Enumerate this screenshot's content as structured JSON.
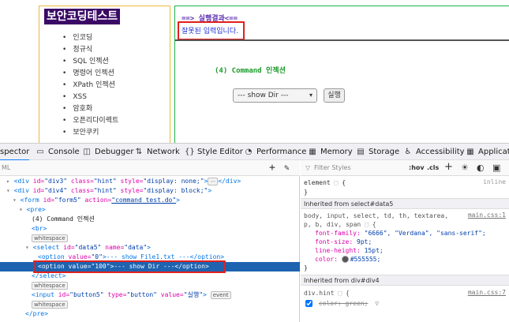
{
  "page": {
    "site_title": "보안코딩테스트",
    "nav": [
      "인코딩",
      "정규식",
      "SQL 인젝션",
      "명령어 인젝션",
      "XPath 인젝션",
      "XSS",
      "암호화",
      "오픈리다이렉트",
      "보안쿠키"
    ],
    "result_title": "==> 실행결과<==",
    "result_message": "잘못된 입력입니다.",
    "command_title": "(4) Command 인젝션",
    "select_value": "--- show Dir ---",
    "run_button": "실행"
  },
  "devtools": {
    "tabs": [
      "spector",
      "Console",
      "Debugger",
      "Network",
      "Style Editor",
      "Performance",
      "Memory",
      "Storage",
      "Accessibility",
      "Applicatio"
    ],
    "left_toolbar_label": "ML",
    "tree": {
      "l1_tag": "<div ",
      "l1_a1": "id=",
      "l1_v1": "\"div3\"",
      "l1_a2": " class=",
      "l1_v2": "\"hint\"",
      "l1_a3": " style=",
      "l1_v3": "\"display: none;\"",
      "l1_end": ">",
      "l1_close": "</div>",
      "l2_tag": "<div ",
      "l2_a1": "id=",
      "l2_v1": "\"div4\"",
      "l2_a2": " class=",
      "l2_v2": "\"hint\"",
      "l2_a3": " style=",
      "l2_v3": "\"display: block;\"",
      "l2_end": ">",
      "l3_tag": "<form ",
      "l3_a1": "id=",
      "l3_v1": "\"form5\"",
      "l3_a2": " action=",
      "l3_v2": "\"command_test.do\"",
      "l3_end": ">",
      "l4": "<pre>",
      "l5": "(4) Command 인젝션",
      "l6": "<br>",
      "ws": "whitespace",
      "l8_tag": "<select ",
      "l8_a1": "id=",
      "l8_v1": "\"data5\"",
      "l8_a2": " name=",
      "l8_v2": "\"data\"",
      "l8_end": ">",
      "l9_tag": "<option ",
      "l9_a1": "value=",
      "l9_v1": "\"0\"",
      "l9_text": ">--- show File1.txt ---</option>",
      "l10_tag": "<option ",
      "l10_a1": "value=",
      "l10_v1": "\"100\"",
      "l10_text": ">--- show Dir ---</option>",
      "l11": "</select>",
      "l13_tag": "<input ",
      "l13_a1": "id=",
      "l13_v1": "\"button5\"",
      "l13_a2": " type=",
      "l13_v2": "\"button\"",
      "l13_a3": " value=",
      "l13_v3": "\"실행\"",
      "l13_end": ">",
      "event": "event",
      "l15": "</pre>"
    },
    "rules": {
      "filter_placeholder": "Filter Styles",
      "hov": ":hov",
      "cls": ".cls",
      "element_rule": "element",
      "element_brace_open": "{",
      "element_brace_close": "}",
      "inline": "inline",
      "inherited1": "Inherited from select#data5",
      "selector1a": "body, input, select, td, th, textarea,",
      "selector1b": "p, b, div, span",
      "source1": "main.css:1",
      "p1_name": "font-family:",
      "p1_value": "\"6666\", \"Verdana\", \"sans-serif\";",
      "p2_name": "font-size:",
      "p2_value": "9pt;",
      "p3_name": "line-height:",
      "p3_value": "15pt;",
      "p4_name": "color:",
      "p4_value": "#555555;",
      "close1": "}",
      "inherited2": "Inherited from div#div4",
      "selector2": "div.hint",
      "source2": "main.css:7",
      "p5": "color: green;"
    }
  },
  "colors": {
    "accent": "#0a84ff",
    "highlight_red": "#e0201e",
    "selected_row": "#1e63b0",
    "sidebar_title_bg": "#3a0a66",
    "command_green": "#1c9a2a"
  }
}
